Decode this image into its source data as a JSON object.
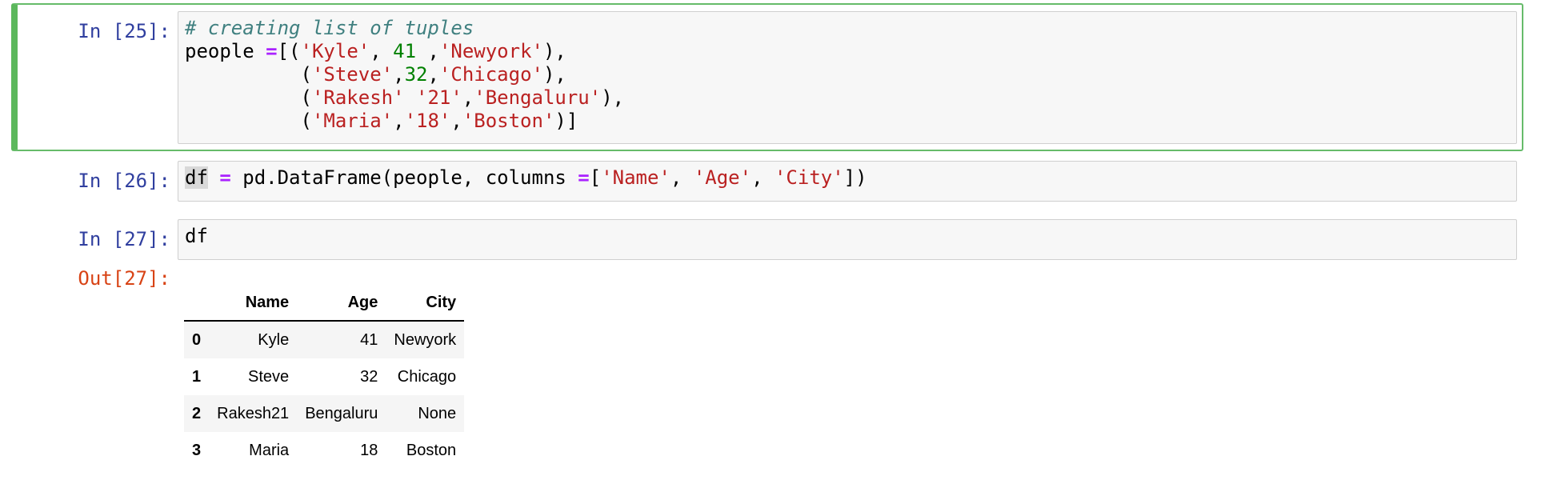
{
  "cells": [
    {
      "prompt": "In [25]:",
      "code_lines": [
        [
          {
            "t": "comment",
            "v": "# creating list of tuples"
          }
        ],
        [
          {
            "t": "plain",
            "v": "people "
          },
          {
            "t": "op",
            "v": "="
          },
          {
            "t": "plain",
            "v": "[("
          },
          {
            "t": "str",
            "v": "'Kyle'"
          },
          {
            "t": "plain",
            "v": ", "
          },
          {
            "t": "num",
            "v": "41"
          },
          {
            "t": "plain",
            "v": " ,"
          },
          {
            "t": "str",
            "v": "'Newyork'"
          },
          {
            "t": "plain",
            "v": "),"
          }
        ],
        [
          {
            "t": "plain",
            "v": "          ("
          },
          {
            "t": "str",
            "v": "'Steve'"
          },
          {
            "t": "plain",
            "v": ","
          },
          {
            "t": "num",
            "v": "32"
          },
          {
            "t": "plain",
            "v": ","
          },
          {
            "t": "str",
            "v": "'Chicago'"
          },
          {
            "t": "plain",
            "v": "),"
          }
        ],
        [
          {
            "t": "plain",
            "v": "          ("
          },
          {
            "t": "str",
            "v": "'Rakesh'"
          },
          {
            "t": "plain",
            "v": " "
          },
          {
            "t": "str",
            "v": "'21'"
          },
          {
            "t": "plain",
            "v": ","
          },
          {
            "t": "str",
            "v": "'Bengaluru'"
          },
          {
            "t": "plain",
            "v": "),"
          }
        ],
        [
          {
            "t": "plain",
            "v": "          ("
          },
          {
            "t": "str",
            "v": "'Maria'"
          },
          {
            "t": "plain",
            "v": ","
          },
          {
            "t": "str",
            "v": "'18'"
          },
          {
            "t": "plain",
            "v": ","
          },
          {
            "t": "str",
            "v": "'Boston'"
          },
          {
            "t": "plain",
            "v": ")]"
          }
        ]
      ]
    },
    {
      "prompt": "In [26]:",
      "code_lines": [
        [
          {
            "t": "hl",
            "v": "df"
          },
          {
            "t": "plain",
            "v": " "
          },
          {
            "t": "op",
            "v": "="
          },
          {
            "t": "plain",
            "v": " pd.DataFrame(people, columns "
          },
          {
            "t": "op",
            "v": "="
          },
          {
            "t": "plain",
            "v": "["
          },
          {
            "t": "str",
            "v": "'Name'"
          },
          {
            "t": "plain",
            "v": ", "
          },
          {
            "t": "str",
            "v": "'Age'"
          },
          {
            "t": "plain",
            "v": ", "
          },
          {
            "t": "str",
            "v": "'City'"
          },
          {
            "t": "plain",
            "v": "])"
          }
        ]
      ]
    },
    {
      "prompt": "In [27]:",
      "code_lines": [
        [
          {
            "t": "plain",
            "v": "df"
          }
        ]
      ]
    }
  ],
  "output": {
    "prompt": "Out[27]:",
    "table": {
      "columns": [
        "",
        "Name",
        "Age",
        "City"
      ],
      "rows": [
        [
          "0",
          "Kyle",
          "41",
          "Newyork"
        ],
        [
          "1",
          "Steve",
          "32",
          "Chicago"
        ],
        [
          "2",
          "Rakesh21",
          "Bengaluru",
          "None"
        ],
        [
          "3",
          "Maria",
          "18",
          "Boston"
        ]
      ]
    }
  },
  "colors": {
    "prompt_in": "#303f9f",
    "prompt_out": "#d84315",
    "selected_border": "#5cb85c",
    "string": "#ba2121",
    "number": "#008000",
    "operator": "#aa22ff",
    "comment": "#408080"
  }
}
